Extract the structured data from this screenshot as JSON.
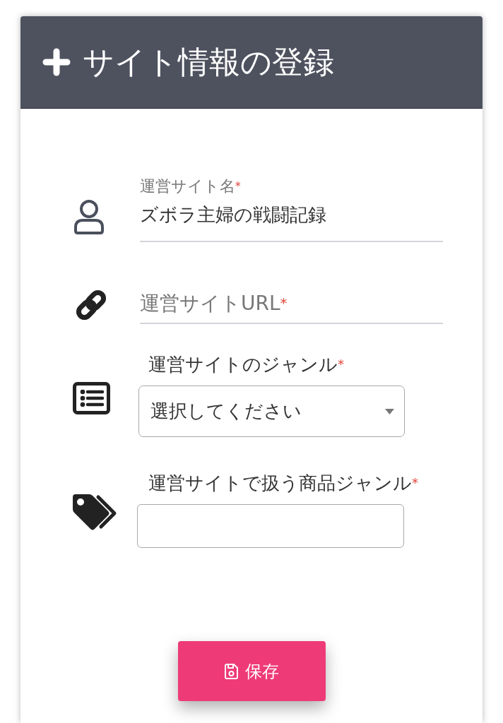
{
  "header": {
    "title": "サイト情報の登録"
  },
  "fields": [
    {
      "kind": "underline",
      "label": "運営サイト名",
      "required_mark": "*",
      "value": "ズボラ主婦の戦闘記録"
    },
    {
      "kind": "underline",
      "label": "運営サイトURL",
      "required_mark": "*"
    },
    {
      "kind": "select",
      "label": "運営サイトのジャンル",
      "required_mark": "*",
      "placeholder": "選択してください"
    },
    {
      "kind": "text",
      "label": "運営サイトで扱う商品ジャンル",
      "required_mark": "*"
    }
  ],
  "save_button": {
    "label": "保存"
  }
}
